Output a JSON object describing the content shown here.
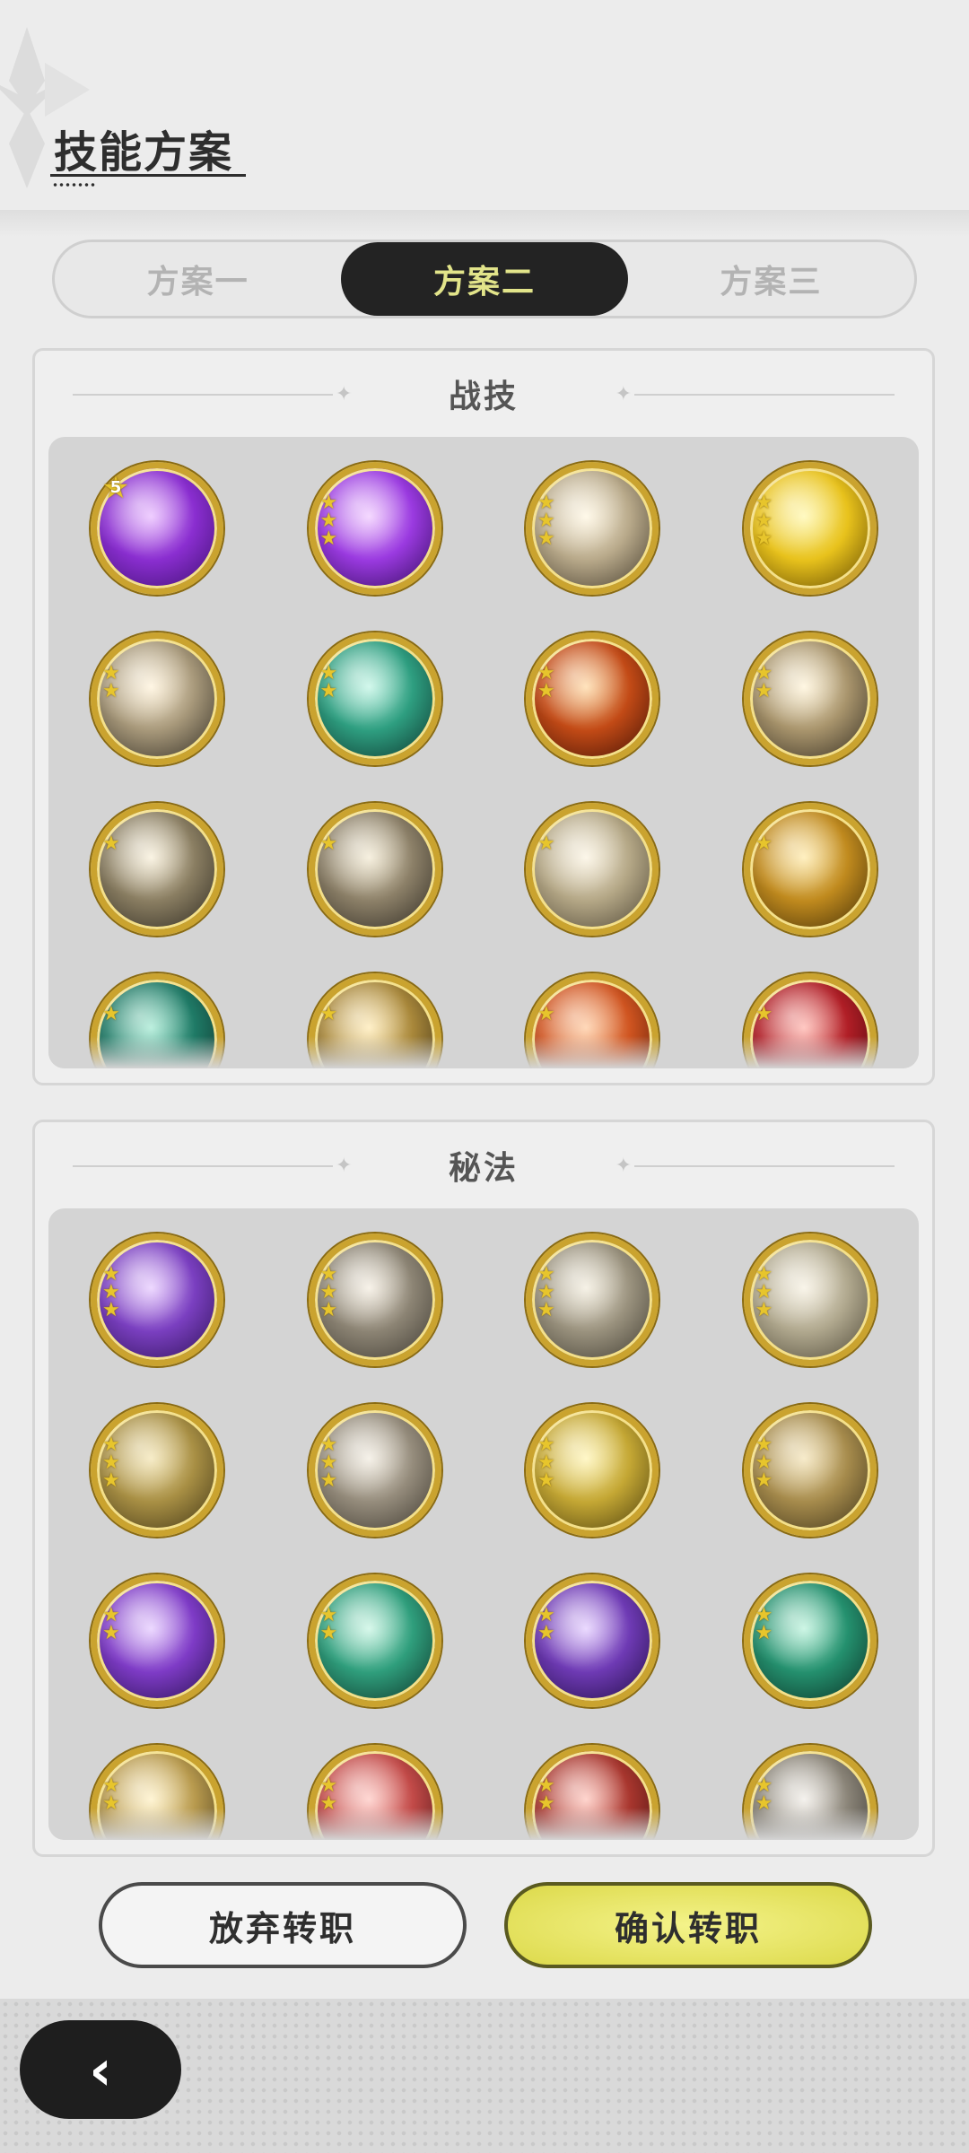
{
  "page_title": "技能方案",
  "tabs": [
    {
      "label": "方案一",
      "active": false
    },
    {
      "label": "方案二",
      "active": true
    },
    {
      "label": "方案三",
      "active": false
    }
  ],
  "combat_panel": {
    "title": "战技",
    "skills": [
      {
        "icon": "purple-comet-skill-icon",
        "stars": 0,
        "rank": "5",
        "colors": [
          "#e8b8ff",
          "#8a2ed0",
          "#3a0f6a"
        ]
      },
      {
        "icon": "purple-heart-skill-icon",
        "stars": 3,
        "colors": [
          "#f0c8ff",
          "#9a3ae0",
          "#2e0a55"
        ]
      },
      {
        "icon": "palm-strike-skill-icon",
        "stars": 3,
        "colors": [
          "#fff6e0",
          "#b8a98a",
          "#3e3628"
        ]
      },
      {
        "icon": "golden-shield-skill-icon",
        "stars": 3,
        "colors": [
          "#fff7a8",
          "#e8c21c",
          "#5a4200"
        ]
      },
      {
        "icon": "sword-thrust-skill-icon",
        "stars": 2,
        "colors": [
          "#fff2d8",
          "#a7987a",
          "#2c2820"
        ]
      },
      {
        "icon": "jade-sword-skill-icon",
        "stars": 2,
        "colors": [
          "#bff5e4",
          "#2e9e80",
          "#0b2e28"
        ]
      },
      {
        "icon": "flame-burst-skill-icon",
        "stars": 2,
        "colors": [
          "#ffd7a0",
          "#c24a16",
          "#3a0e04"
        ]
      },
      {
        "icon": "falling-blade-skill-icon",
        "stars": 2,
        "colors": [
          "#fff3d6",
          "#a8946c",
          "#2e281e"
        ]
      },
      {
        "icon": "wind-slash-skill-icon",
        "stars": 1,
        "colors": [
          "#f8efd8",
          "#8a7e62",
          "#2a261e"
        ]
      },
      {
        "icon": "whirlwind-skill-icon",
        "stars": 1,
        "colors": [
          "#f3ead2",
          "#8c8068",
          "#2a261f"
        ]
      },
      {
        "icon": "spiral-strike-skill-icon",
        "stars": 1,
        "colors": [
          "#fbf3e0",
          "#b4a786",
          "#4a4232"
        ]
      },
      {
        "icon": "golden-crescent-skill-icon",
        "stars": 1,
        "colors": [
          "#ffe9a6",
          "#c08a1e",
          "#3c2a06"
        ]
      },
      {
        "icon": "teal-gust-skill-icon",
        "stars": 1,
        "colors": [
          "#9fe8d0",
          "#1f7a66",
          "#0b2420"
        ]
      },
      {
        "icon": "golden-slash-skill-icon",
        "stars": 1,
        "colors": [
          "#ffe9b0",
          "#a8873a",
          "#2e2410"
        ]
      },
      {
        "icon": "fire-emblem-skill-icon",
        "stars": 1,
        "colors": [
          "#ffc79a",
          "#cf5420",
          "#4a1404"
        ]
      },
      {
        "icon": "crimson-blade-skill-icon",
        "stars": 1,
        "colors": [
          "#ffb0a8",
          "#b01e26",
          "#3c0408"
        ]
      }
    ]
  },
  "secret_panel": {
    "title": "秘法",
    "skills": [
      {
        "icon": "purple-aura-skill-icon",
        "stars": 3,
        "colors": [
          "#e6c8ff",
          "#7a3fc0",
          "#2a1050"
        ]
      },
      {
        "icon": "stone-blade-skill-icon",
        "stars": 3,
        "colors": [
          "#f4ede0",
          "#8c8474",
          "#3a362e"
        ]
      },
      {
        "icon": "leaf-emblem-skill-icon",
        "stars": 3,
        "colors": [
          "#f2ecdc",
          "#9a927e",
          "#3c382e"
        ]
      },
      {
        "icon": "all-seeing-eye-skill-icon",
        "stars": 3,
        "colors": [
          "#f6f0e0",
          "#b0a88e",
          "#4a4434"
        ]
      },
      {
        "icon": "golden-guardian-skill-icon",
        "stars": 3,
        "colors": [
          "#f3e4b0",
          "#a88f44",
          "#3c3214"
        ]
      },
      {
        "icon": "sword-pillar-skill-icon",
        "stars": 3,
        "colors": [
          "#f2ece0",
          "#958c7c",
          "#3a352c"
        ]
      },
      {
        "icon": "radiant-figure-skill-icon",
        "stars": 3,
        "colors": [
          "#fff4b0",
          "#c4a734",
          "#463a0c"
        ]
      },
      {
        "icon": "golden-armor-skill-icon",
        "stars": 3,
        "colors": [
          "#f3e2b4",
          "#a68b4c",
          "#3a3018"
        ]
      },
      {
        "icon": "shadow-dash-skill-icon",
        "stars": 2,
        "colors": [
          "#e4c8ff",
          "#7e3bc6",
          "#24104a"
        ]
      },
      {
        "icon": "healing-circle-skill-icon",
        "stars": 2,
        "colors": [
          "#c6f5e2",
          "#2f9e7c",
          "#0c2e24"
        ]
      },
      {
        "icon": "violet-figure-skill-icon",
        "stars": 2,
        "colors": [
          "#e2caff",
          "#6e3ab4",
          "#1e0c40"
        ]
      },
      {
        "icon": "emerald-sword-skill-icon",
        "stars": 2,
        "colors": [
          "#b8f2da",
          "#24906e",
          "#0a2a20"
        ]
      },
      {
        "icon": "golden-heal-skill-icon",
        "stars": 2,
        "colors": [
          "#fff0c2",
          "#b89a4e",
          "#3c3016"
        ]
      },
      {
        "icon": "crimson-sword-skill-icon",
        "stars": 2,
        "colors": [
          "#ffc6c0",
          "#c24a48",
          "#401010"
        ]
      },
      {
        "icon": "red-crystal-skill-icon",
        "stars": 2,
        "colors": [
          "#ffc2b8",
          "#a8362e",
          "#3a0c0a"
        ]
      },
      {
        "icon": "silver-warrior-skill-icon",
        "stars": 2,
        "colors": [
          "#f0ece6",
          "#8a8478",
          "#2e2b26"
        ]
      }
    ]
  },
  "buttons": {
    "abandon": "放弃转职",
    "confirm": "确认转职",
    "back_icon": "‹"
  }
}
